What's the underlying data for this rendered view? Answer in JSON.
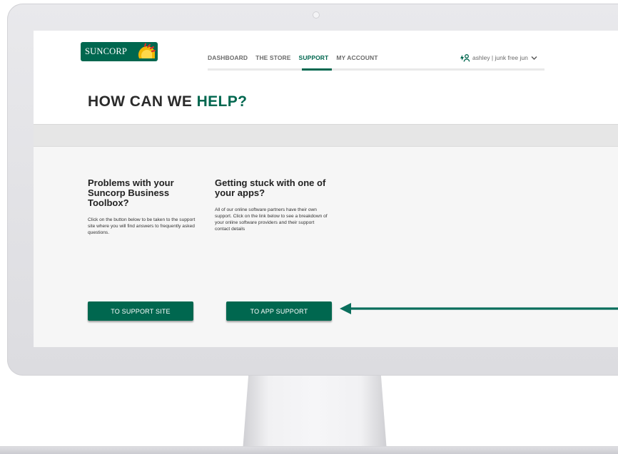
{
  "logo": {
    "text": "SUNCORP"
  },
  "nav": {
    "items": [
      {
        "label": "DASHBOARD",
        "active": false
      },
      {
        "label": "THE STORE",
        "active": false
      },
      {
        "label": "SUPPORT",
        "active": true
      },
      {
        "label": "MY ACCOUNT",
        "active": false
      }
    ]
  },
  "user": {
    "label": "ashley | junk free jun"
  },
  "page": {
    "title_prefix": "HOW CAN WE",
    "title_accent": "HELP?"
  },
  "sections": [
    {
      "heading": "Problems with your Suncorp Business Toolbox?",
      "body": "Click on the button below to be taken to the support site where you will find answers to frequently asked questions.",
      "button": "TO SUPPORT SITE"
    },
    {
      "heading": "Getting stuck with one of your apps?",
      "body": "All of our online software partners have their own support. Click on the link below to see a breakdown of your online software providers and their support contact details",
      "button": "TO APP SUPPORT"
    }
  ],
  "colors": {
    "brand_green": "#00674f",
    "logo_accent": "#f2b705",
    "logo_red": "#d6332a"
  },
  "icons": {
    "user": "user-switch-icon",
    "dropdown": "chevron-down-icon",
    "annotation": "arrow-left-icon"
  }
}
